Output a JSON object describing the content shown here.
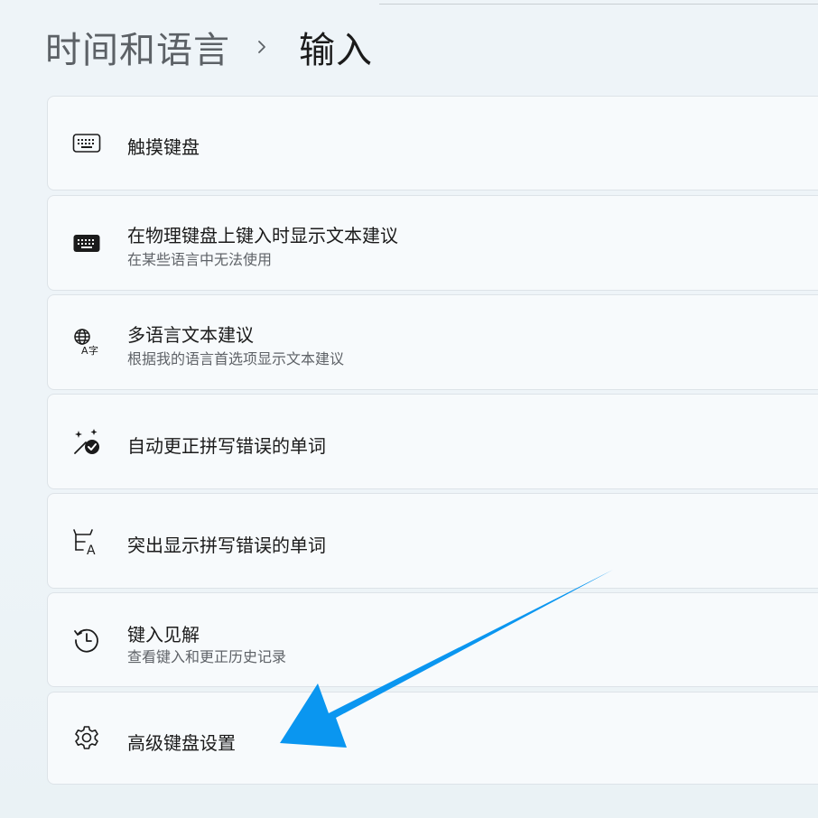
{
  "breadcrumb": {
    "parent": "时间和语言",
    "current": "输入"
  },
  "settings": [
    {
      "icon": "keyboard-icon",
      "title": "触摸键盘",
      "desc": ""
    },
    {
      "icon": "keyboard-filled-icon",
      "title": "在物理键盘上键入时显示文本建议",
      "desc": "在某些语言中无法使用"
    },
    {
      "icon": "globe-language-icon",
      "title": "多语言文本建议",
      "desc": "根据我的语言首选项显示文本建议"
    },
    {
      "icon": "magic-wand-check-icon",
      "title": "自动更正拼写错误的单词",
      "desc": ""
    },
    {
      "icon": "spell-check-icon",
      "title": "突出显示拼写错误的单词",
      "desc": ""
    },
    {
      "icon": "history-icon",
      "title": "键入见解",
      "desc": "查看键入和更正历史记录"
    },
    {
      "icon": "gear-icon",
      "title": "高级键盘设置",
      "desc": ""
    }
  ],
  "colors": {
    "annotation_arrow": "#0a96f0",
    "card_background": "#f7fafc",
    "page_background": "#eef4f8"
  }
}
